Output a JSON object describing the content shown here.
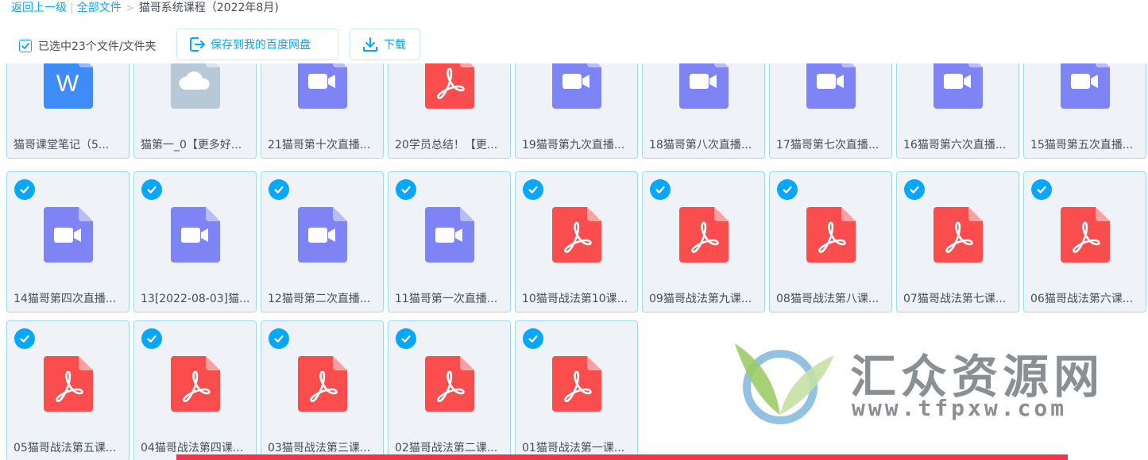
{
  "breadcrumb": {
    "back": "返回上一级",
    "all_files": "全部文件",
    "current": "猫哥系统课程（2022年8月)"
  },
  "toolbar": {
    "selected_label": "已选中23个文件/文件夹",
    "save_label": "保存到我的百度网盘",
    "download_label": "下载"
  },
  "colors": {
    "accent": "#06a7ff",
    "video": "#7e84f3",
    "pdf": "#fa4e4e",
    "word": "#3e8cf7",
    "cloud": "#b9c8d6"
  },
  "files": [
    {
      "name": "猫哥课堂笔记（5...",
      "type": "word",
      "checked": false
    },
    {
      "name": "猫第一_0【更多好...",
      "type": "cloud",
      "checked": false
    },
    {
      "name": "21猫哥第十次直播...",
      "type": "video",
      "checked": false
    },
    {
      "name": "20学员总结！【更...",
      "type": "pdf",
      "checked": false
    },
    {
      "name": "19猫哥第九次直播...",
      "type": "video",
      "checked": false
    },
    {
      "name": "18猫哥第八次直播...",
      "type": "video",
      "checked": false
    },
    {
      "name": "17猫哥第七次直播...",
      "type": "video",
      "checked": false
    },
    {
      "name": "16猫哥第六次直播...",
      "type": "video",
      "checked": false
    },
    {
      "name": "15猫哥第五次直播...",
      "type": "video",
      "checked": false
    },
    {
      "name": "14猫哥第四次直播...",
      "type": "video",
      "checked": true
    },
    {
      "name": "13[2022-08-03]猫...",
      "type": "video",
      "checked": true
    },
    {
      "name": "12猫哥第二次直播...",
      "type": "video",
      "checked": true
    },
    {
      "name": "11猫哥第一次直播...",
      "type": "video",
      "checked": true
    },
    {
      "name": "10猫哥战法第10课...",
      "type": "pdf",
      "checked": true
    },
    {
      "name": "09猫哥战法第九课...",
      "type": "pdf",
      "checked": true
    },
    {
      "name": "08猫哥战法第八课...",
      "type": "pdf",
      "checked": true
    },
    {
      "name": "07猫哥战法第七课...",
      "type": "pdf",
      "checked": true
    },
    {
      "name": "06猫哥战法第六课...",
      "type": "pdf",
      "checked": true
    },
    {
      "name": "05猫哥战法第五课...",
      "type": "pdf",
      "checked": true
    },
    {
      "name": "04猫哥战法第四课...",
      "type": "pdf",
      "checked": true
    },
    {
      "name": "03猫哥战法第三课...",
      "type": "pdf",
      "checked": true
    },
    {
      "name": "02猫哥战法第二课...",
      "type": "pdf",
      "checked": true
    },
    {
      "name": "01猫哥战法第一课...",
      "type": "pdf",
      "checked": true
    }
  ],
  "watermark": {
    "title": "汇众资源网",
    "url": "www.tfpxw.com"
  }
}
